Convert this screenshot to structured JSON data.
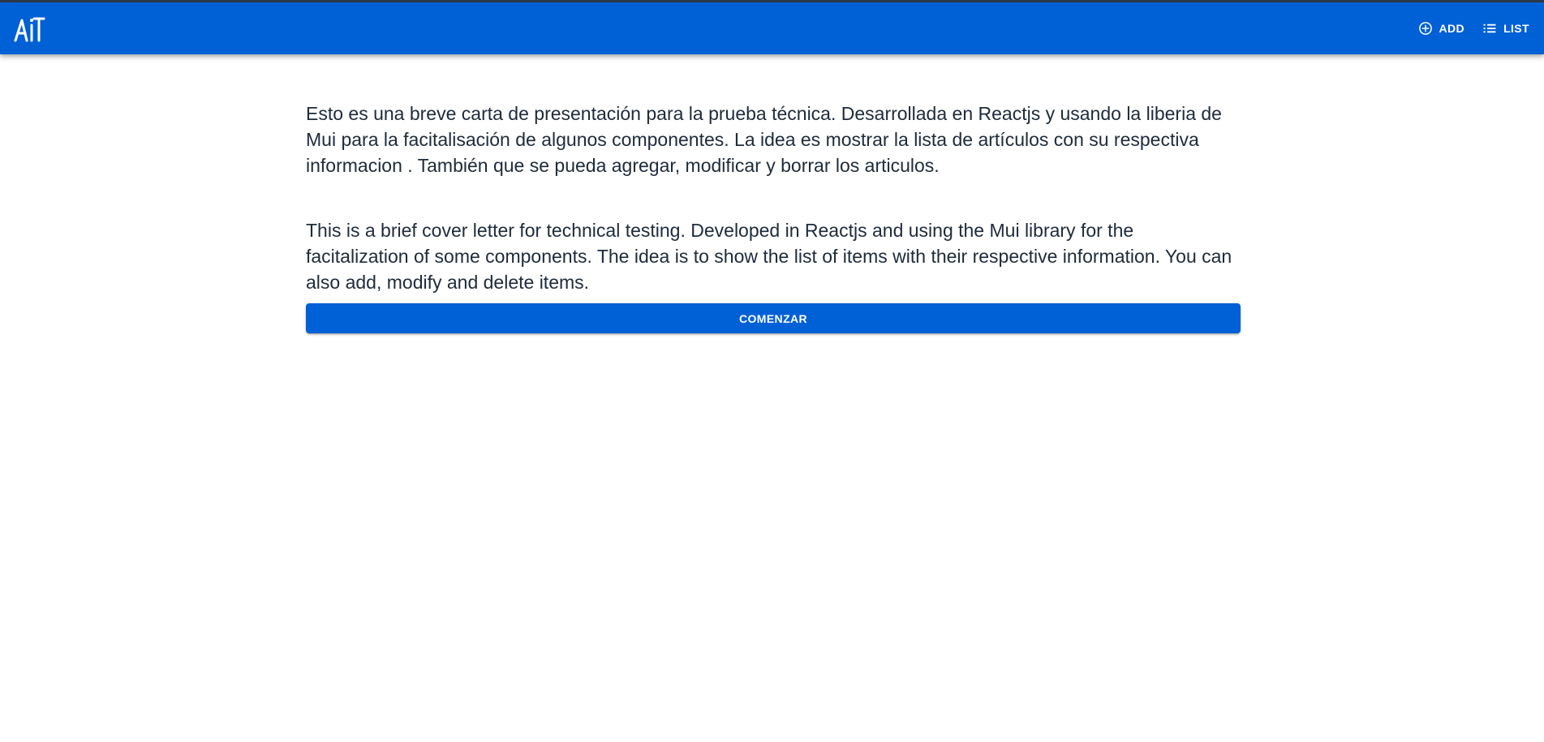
{
  "header": {
    "logo_icon": "ait-logo",
    "nav": [
      {
        "label": "ADD",
        "icon": "add-circle-outline-icon"
      },
      {
        "label": "LIST",
        "icon": "list-icon"
      }
    ],
    "color": "#0060d6"
  },
  "main": {
    "paragraph_es": "Esto es una breve carta de presentación para la prueba técnica. Desarrollada en Reactjs y usando la liberia de Mui para la facitalisación de algunos componentes. La idea es mostrar la lista de artículos con su respectiva informacion . También que se pueda agregar, modificar y borrar los articulos.",
    "paragraph_en": "This is a brief cover letter for technical testing. Developed in Reactjs and using the Mui library for the facitalization of some components. The idea is to show the list of items with their respective information. You can also add, modify and delete items.",
    "start_button_label": "COMENZAR"
  },
  "colors": {
    "primary": "#0060d6",
    "text": "#1e2b3b",
    "background": "#ffffff"
  }
}
